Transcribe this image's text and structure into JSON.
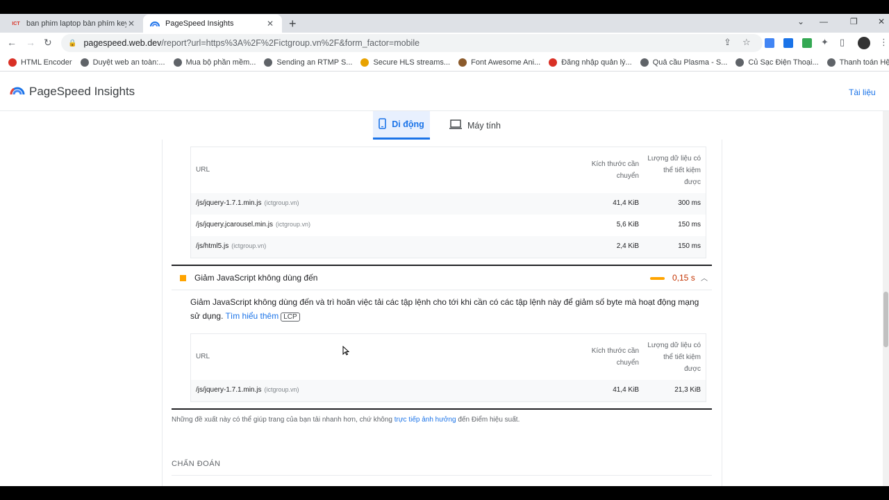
{
  "browser": {
    "tabs": [
      {
        "title": "ban phim laptop bàn phím keyb",
        "favicon": "ict-favicon"
      },
      {
        "title": "PageSpeed Insights",
        "favicon": "pagespeed-favicon"
      }
    ],
    "url_host": "pagespeed.web.dev",
    "url_path": "/report?url=https%3A%2F%2Fictgroup.vn%2F&form_factor=mobile",
    "bookmarks": [
      {
        "label": "HTML Encoder",
        "color": "#d93025"
      },
      {
        "label": "Duyệt web an toàn:...",
        "color": "#5f6368"
      },
      {
        "label": "Mua bộ phần mềm...",
        "color": "#5f6368"
      },
      {
        "label": "Sending an RTMP S...",
        "color": "#5f6368"
      },
      {
        "label": "Secure HLS streams...",
        "color": "#e8a200"
      },
      {
        "label": "Font Awesome Ani...",
        "color": "#8b5a2b"
      },
      {
        "label": "Đăng nhập quản lý...",
        "color": "#d93025"
      },
      {
        "label": "Quả cầu Plasma - S...",
        "color": "#5f6368"
      },
      {
        "label": "Củ Sạc Điện Thoại...",
        "color": "#5f6368"
      },
      {
        "label": "Thanh toán Hệ thố...",
        "color": "#5f6368"
      }
    ]
  },
  "header": {
    "brand": "PageSpeed Insights",
    "docs_link": "Tài liệu"
  },
  "device_tabs": {
    "mobile": "Di động",
    "desktop": "Máy tính"
  },
  "table1": {
    "columns": {
      "url": "URL",
      "size": "Kích thước cần chuyển",
      "savings": "Lượng dữ liệu có thể tiết kiệm được"
    },
    "rows": [
      {
        "url": "/js/jquery-1.7.1.min.js",
        "domain": "(ictgroup.vn)",
        "size": "41,4 KiB",
        "savings": "300 ms"
      },
      {
        "url": "/js/jquery.jcarousel.min.js",
        "domain": "(ictgroup.vn)",
        "size": "5,6 KiB",
        "savings": "150 ms"
      },
      {
        "url": "/js/html5.js",
        "domain": "(ictgroup.vn)",
        "size": "2,4 KiB",
        "savings": "150 ms"
      }
    ]
  },
  "audit": {
    "title": "Giảm JavaScript không dùng đến",
    "value": "0,15 s",
    "status_color": "#ffa400",
    "description": "Giảm JavaScript không dùng đến và trì hoãn việc tải các tập lệnh cho tới khi cần có các tập lệnh này để giảm số byte mà hoạt động mạng sử dụng.",
    "learn_more": "Tìm hiểu thêm",
    "badge": "LCP"
  },
  "table2": {
    "columns": {
      "url": "URL",
      "size": "Kích thước cần chuyển",
      "savings": "Lượng dữ liệu có thể tiết kiệm được"
    },
    "rows": [
      {
        "url": "/js/jquery-1.7.1.min.js",
        "domain": "(ictgroup.vn)",
        "size": "41,4 KiB",
        "savings": "21,3 KiB"
      }
    ]
  },
  "note": {
    "before": "Những đề xuất này có thể giúp trang của bạn tải nhanh hơn, chứ không",
    "link": "trực tiếp ảnh hưởng",
    "after": "đến Điểm hiệu suất."
  },
  "section_title": "CHẨN ĐOÁN"
}
